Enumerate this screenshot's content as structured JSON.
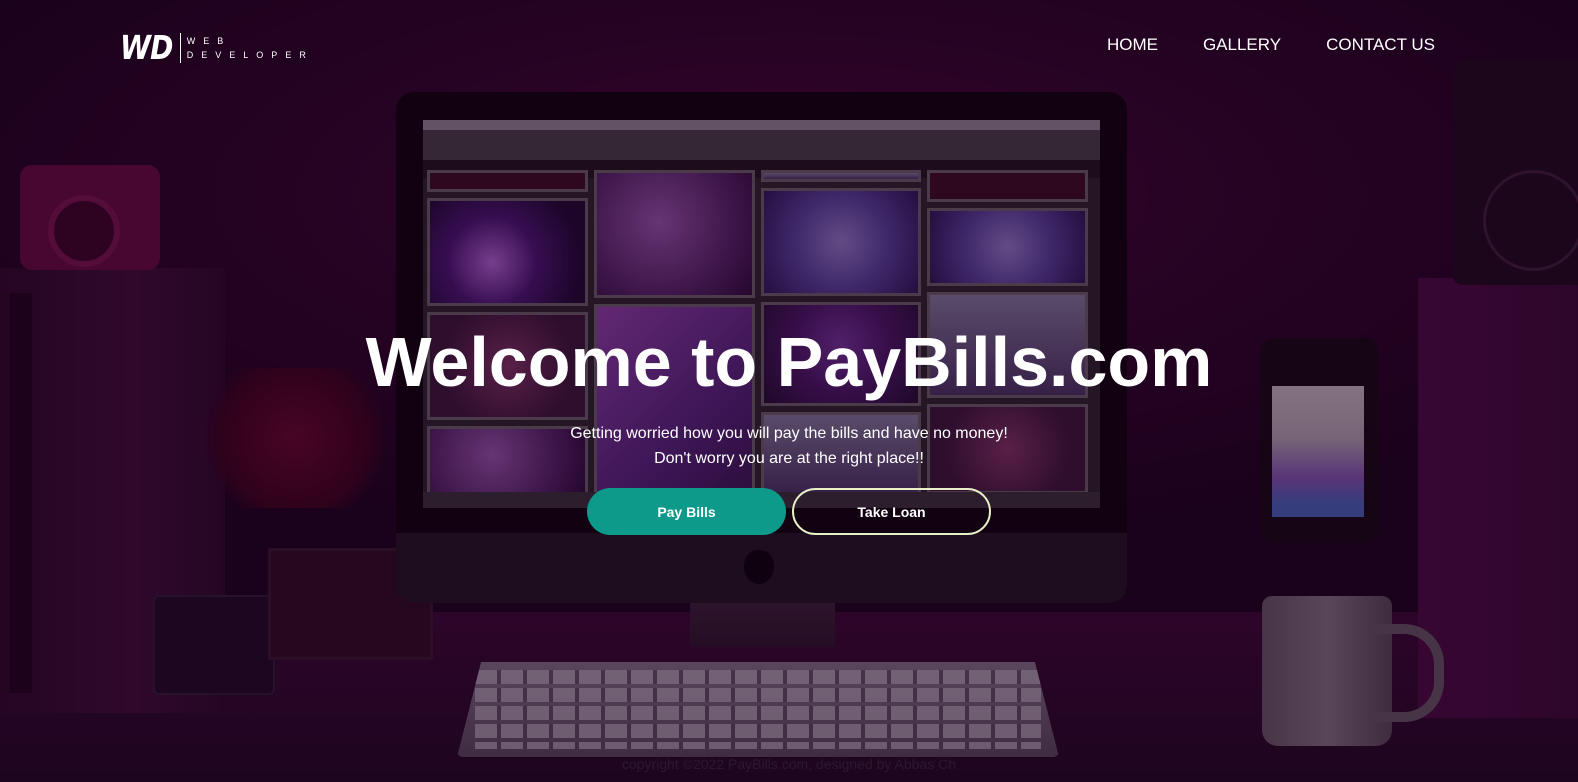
{
  "brand": {
    "mark": "WD",
    "line1": "WEB",
    "line2": "DEVELOPER"
  },
  "nav": {
    "home": "HOME",
    "gallery": "GALLERY",
    "contact": "CONTACT US"
  },
  "hero": {
    "title": "Welcome to PayBills.com",
    "subtitle_line1": "Getting worried how you will pay the bills and have no money!",
    "subtitle_line2": "Don't worry you are at the right place!!"
  },
  "buttons": {
    "pay": "Pay Bills",
    "loan": "Take Loan"
  },
  "footer": {
    "text": "copyright ©2022 PayBills.com, designed by Abbas Ch"
  },
  "colors": {
    "accent": "#0e9a8b",
    "outline": "#e8f0c8",
    "overlay": "#1e001e"
  }
}
